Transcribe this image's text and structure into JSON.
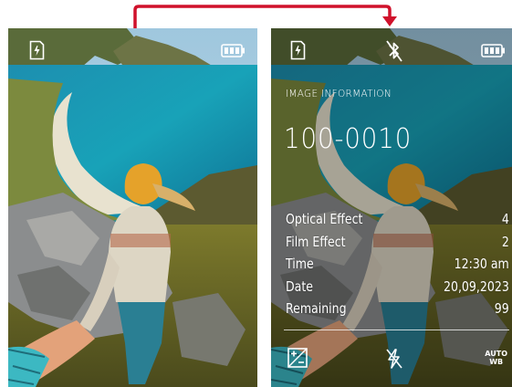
{
  "screen_left": {
    "icons": [
      "sd-card-icon",
      "battery-icon"
    ]
  },
  "screen_right": {
    "icons": [
      "sd-card-icon",
      "bluetooth-off-icon",
      "battery-icon",
      "exposure-compensation-icon",
      "flash-off-icon"
    ],
    "heading": "IMAGE INFORMATION",
    "image_number": "100-0010",
    "rows": [
      {
        "label": "Optical Effect",
        "value": "4"
      },
      {
        "label": "Film Effect",
        "value": "2"
      },
      {
        "label": "Time",
        "value": "12:30 am"
      },
      {
        "label": "Date",
        "value": "20,09,2023"
      },
      {
        "label": "Remaining",
        "value": "99"
      }
    ],
    "wb_line1": "AUTO",
    "wb_line2": "WB"
  },
  "colors": {
    "arrow": "#d0112b",
    "text": "#ffffff"
  }
}
